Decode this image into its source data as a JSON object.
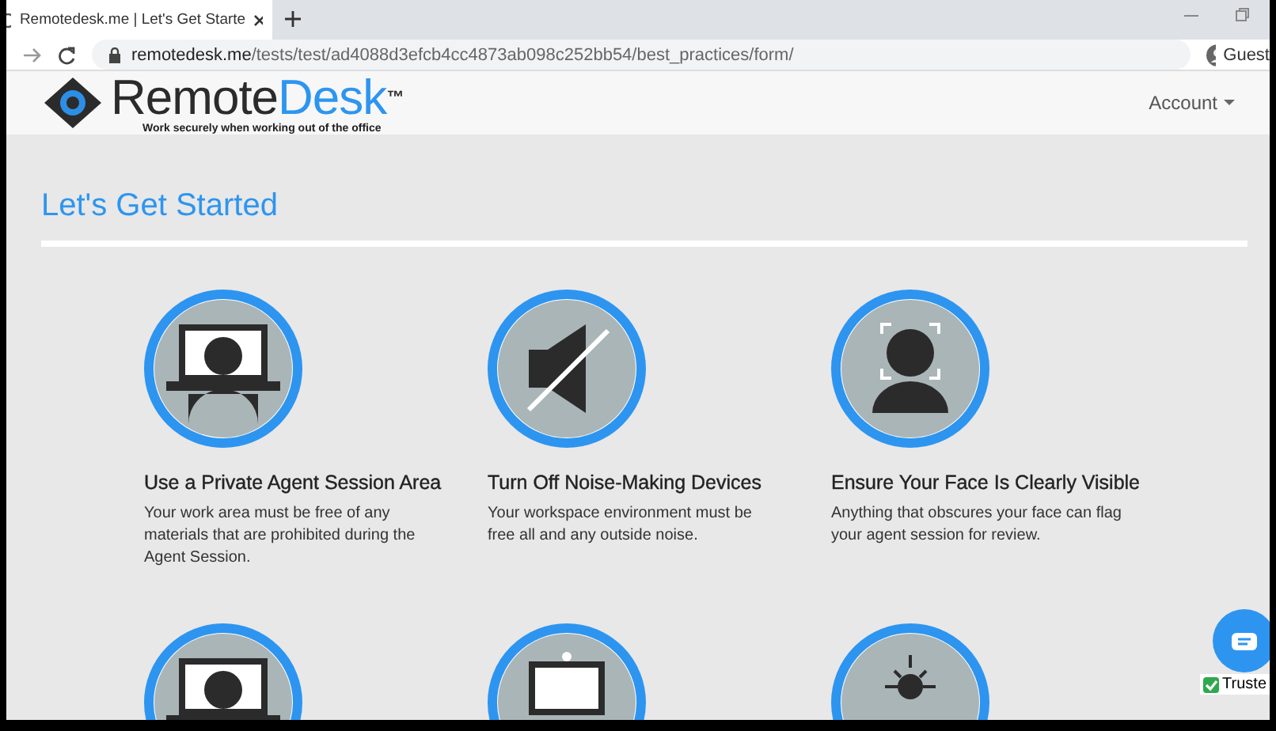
{
  "browser": {
    "tab_title": "Remotedesk.me | Let's Get Starte",
    "url_host": "remotedesk.me",
    "url_path": "/tests/test/ad4088d3efcb4cc4873ab098c252bb54/best_practices/form/",
    "profile": "Guest"
  },
  "header": {
    "logo": {
      "brand_dark": "Remote",
      "brand_blue": "Desk",
      "trademark": "™",
      "tagline": "Work securely when working out of the office"
    },
    "account_menu": "Account"
  },
  "page_title": "Let's Get Started",
  "cards": [
    {
      "kind": "desk",
      "title": "Use a Private Agent Session Area",
      "description": "Your work area must be free of any materials that are prohibited during the Agent Session."
    },
    {
      "kind": "mute",
      "title": "Turn Off Noise-Making Devices",
      "description": "Your workspace environment must be free all and any outside noise."
    },
    {
      "kind": "face",
      "title": "Ensure Your Face Is Clearly Visible",
      "description": "Anything that obscures your face can flag your agent session for review."
    }
  ],
  "next_cards": [
    {
      "kind": "desk"
    },
    {
      "kind": "monitor"
    },
    {
      "kind": "light"
    }
  ],
  "trust_badge": "Truste"
}
